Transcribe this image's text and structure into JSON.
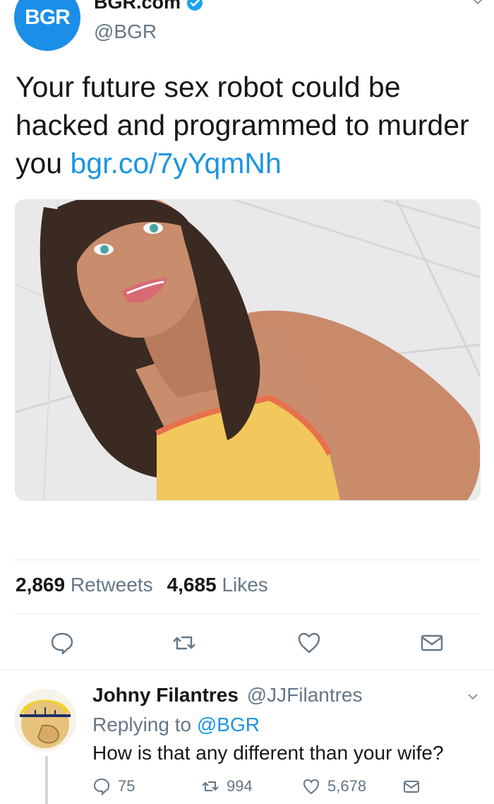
{
  "tweet": {
    "avatar_text": "BGR",
    "display_name": "BGR.com",
    "handle": "@BGR",
    "text": "Your future sex robot could be hacked and programmed to murder you ",
    "link": "bgr.co/7yYqmNh",
    "stats": {
      "retweets_count": "2,869",
      "retweets_label": "Retweets",
      "likes_count": "4,685",
      "likes_label": "Likes"
    },
    "actions": [
      "reply-icon",
      "retweet-icon",
      "like-icon",
      "direct-message-icon"
    ]
  },
  "reply": {
    "display_name": "Johny Filantres",
    "handle": "@JJFilantres",
    "replying_to_label": "Replying to",
    "replying_to_handle": "@BGR",
    "text": "How is that any different than your wife?",
    "reply_count": "75",
    "retweet_count": "994",
    "like_count": "5,678"
  },
  "colors": {
    "brand_blue": "#1b8fe8",
    "link_blue": "#1b95e0",
    "secondary_text": "#657786",
    "divider": "#e6ecf0"
  }
}
